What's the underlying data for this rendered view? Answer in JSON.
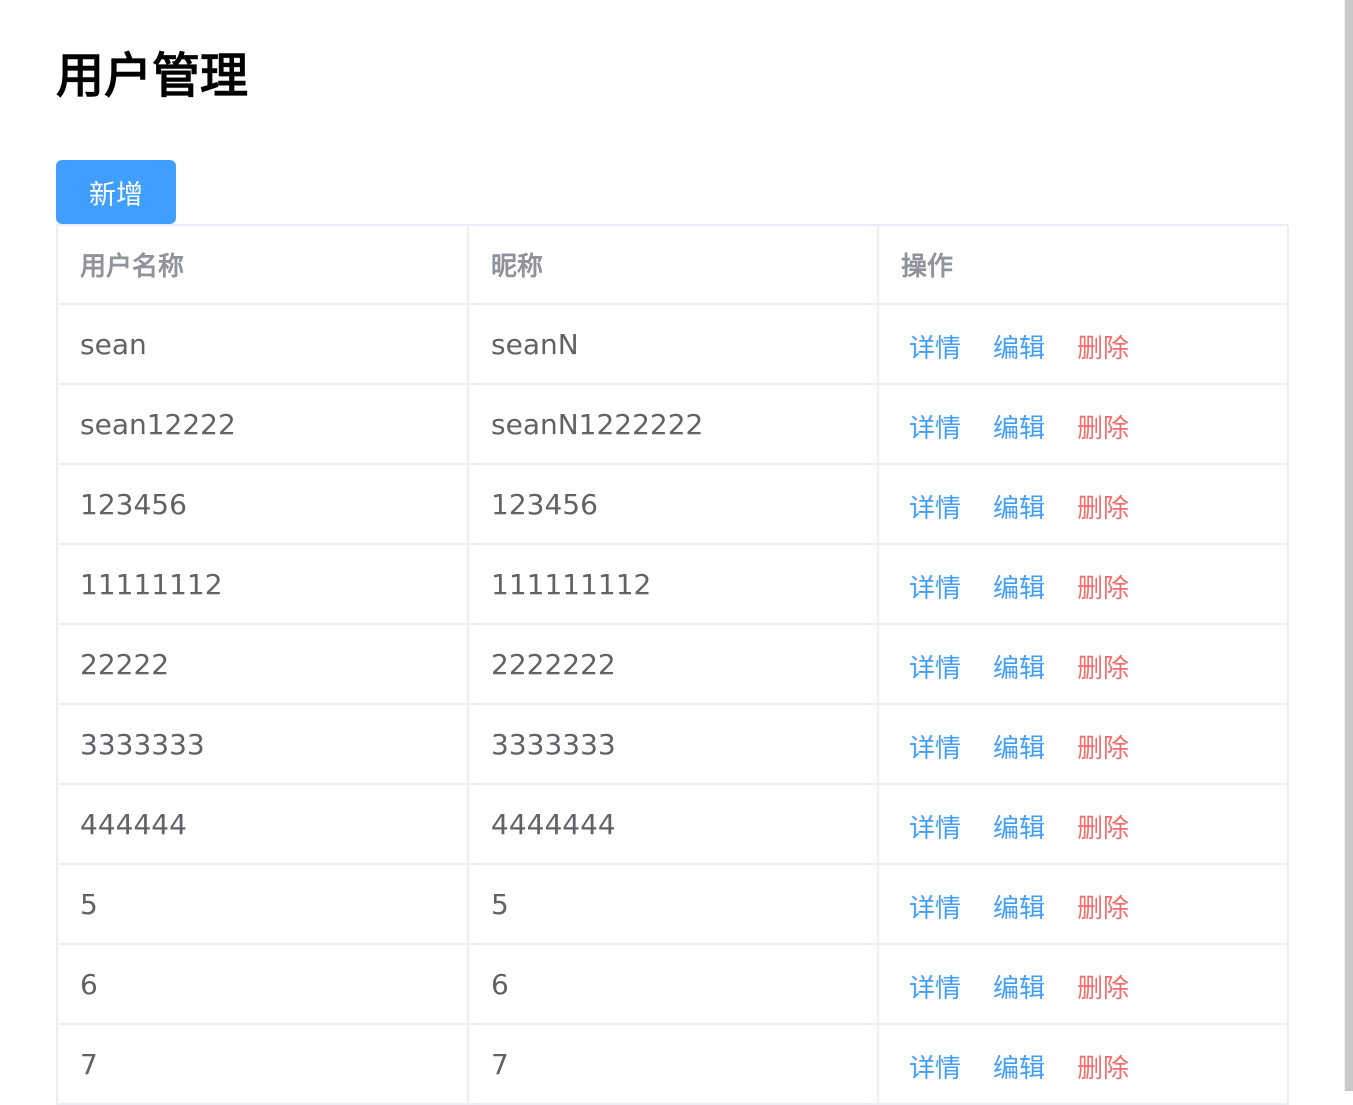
{
  "page": {
    "title": "用户管理"
  },
  "toolbar": {
    "add_label": "新增"
  },
  "table": {
    "headers": [
      "用户名称",
      "昵称",
      "操作"
    ],
    "rows": [
      {
        "username": "sean",
        "nickname": "seanN"
      },
      {
        "username": "sean12222",
        "nickname": "seanN1222222"
      },
      {
        "username": "123456",
        "nickname": "123456"
      },
      {
        "username": "11111112",
        "nickname": "111111112"
      },
      {
        "username": "22222",
        "nickname": "2222222"
      },
      {
        "username": "3333333",
        "nickname": "3333333"
      },
      {
        "username": "444444",
        "nickname": "4444444"
      },
      {
        "username": "5",
        "nickname": "5"
      },
      {
        "username": "6",
        "nickname": "6"
      },
      {
        "username": "7",
        "nickname": "7"
      }
    ],
    "actions": {
      "detail": "详情",
      "edit": "编辑",
      "delete": "删除"
    }
  },
  "colors": {
    "primary": "#409eff",
    "danger": "#f56c6c",
    "header_text": "#909399",
    "cell_text": "#606266",
    "border": "#ebeef5"
  }
}
